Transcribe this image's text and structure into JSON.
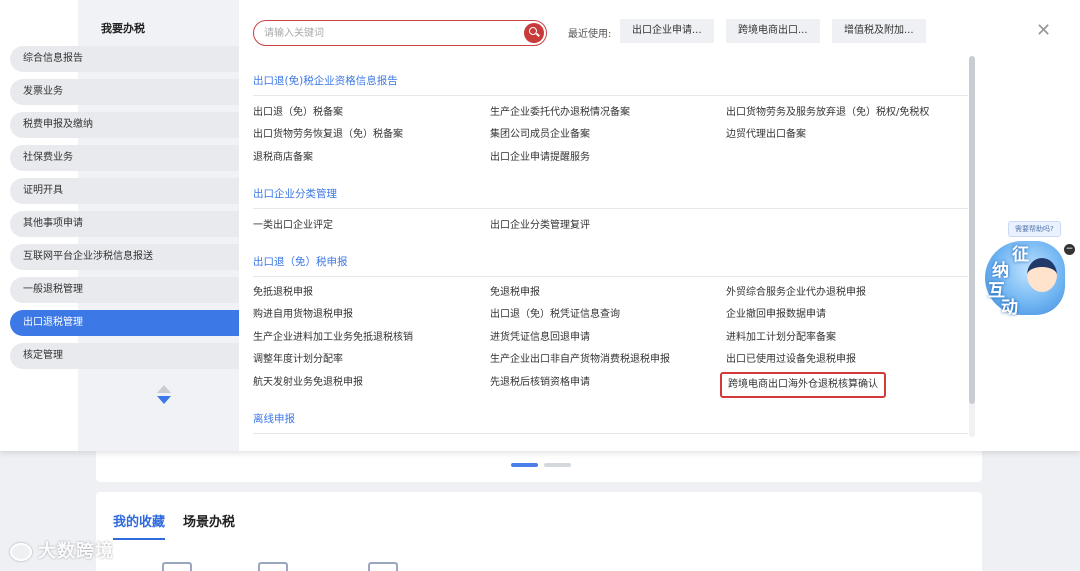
{
  "sidebar": {
    "title": "我要办税",
    "items": [
      {
        "label": "综合信息报告"
      },
      {
        "label": "发票业务"
      },
      {
        "label": "税费申报及缴纳"
      },
      {
        "label": "社保费业务"
      },
      {
        "label": "证明开具"
      },
      {
        "label": "其他事项申请"
      },
      {
        "label": "互联网平台企业涉税信息报送"
      },
      {
        "label": "一般退税管理"
      },
      {
        "label": "出口退税管理"
      },
      {
        "label": "核定管理"
      }
    ],
    "active_index": 8
  },
  "search": {
    "placeholder": "请输入关键词",
    "recent_label": "最近使用:",
    "recent": [
      "出口企业申请...",
      "跨境电商出口...",
      "增值税及附加..."
    ]
  },
  "sections": [
    {
      "title": "出口退(免)税企业资格信息报告",
      "rows": [
        [
          "出口退（免）税备案",
          "生产企业委托代办退税情况备案",
          "出口货物劳务及服务放弃退（免）税权/免税权"
        ],
        [
          "出口货物劳务恢复退（免）税备案",
          "集团公司成员企业备案",
          "边贸代理出口备案"
        ],
        [
          "退税商店备案",
          "出口企业申请提醒服务",
          ""
        ]
      ]
    },
    {
      "title": "出口企业分类管理",
      "rows": [
        [
          "一类出口企业评定",
          "出口企业分类管理复评",
          ""
        ]
      ]
    },
    {
      "title": "出口退（免）税申报",
      "rows": [
        [
          "免抵退税申报",
          "免退税申报",
          "外贸综合服务企业代办退税申报"
        ],
        [
          "购进自用货物退税申报",
          "出口退（免）税凭证信息查询",
          "企业撤回申报数据申请"
        ],
        [
          "生产企业进料加工业务免抵退税核销",
          "进货凭证信息回退申请",
          "进料加工计划分配率备案"
        ],
        [
          "调整年度计划分配率",
          "生产企业出口非自产货物消费税退税申报",
          "出口已使用过设备免退税申报"
        ],
        [
          "航天发射业务免退税申报",
          "先退税后核销资格申请",
          "跨境电商出口海外仓退税核算确认"
        ]
      ]
    },
    {
      "title": "离线申报",
      "rows": []
    }
  ],
  "help": {
    "bubble": "需要帮助吗?",
    "chars": [
      "征",
      "纳",
      "互",
      "动"
    ]
  },
  "background": {
    "tabs": [
      "我的收藏",
      "场景办税"
    ]
  },
  "watermark": "大数跨境",
  "colors": {
    "accent": "#3c78e6",
    "highlight": "#d23a3a"
  }
}
